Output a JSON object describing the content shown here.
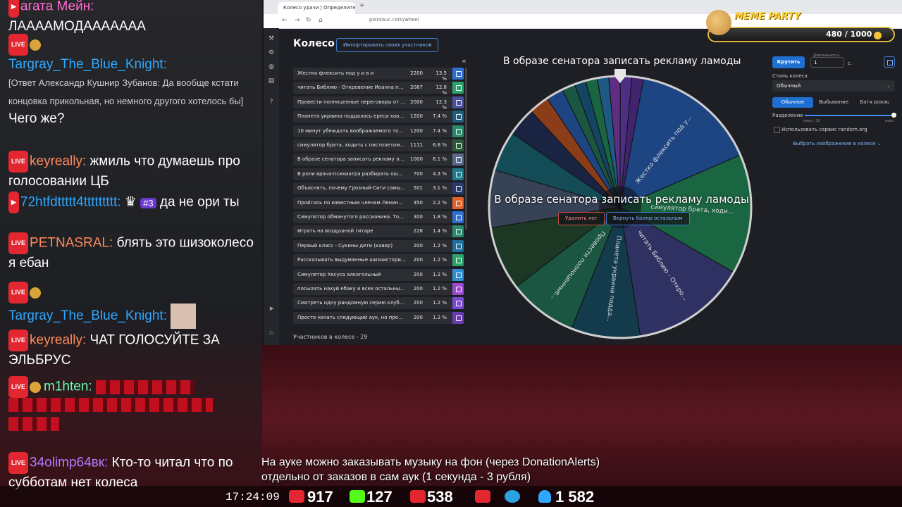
{
  "chat": {
    "messages": [
      {
        "nick": "агата Мейн:",
        "text": "ЛААААМОДААААААА"
      },
      {
        "nick": "Targray_The_Blue_Knight:",
        "reply": "[Ответ Александр Кушнир Зубанов: Да вообще кстати концовка прикольная, но немного другого хотелось бы]",
        "text": "Чего же?"
      },
      {
        "nick": "keyreally:",
        "text": "жмиль что думаешь про голосовании ЦБ"
      },
      {
        "nick": "72htfdttttt4ttttttttt:",
        "badge": "#3",
        "text": "да не ори ты"
      },
      {
        "nick": "PETNASRAL:",
        "text": "блять это шизоколесо я ебан"
      },
      {
        "nick": "Targray_The_Blue_Knight:",
        "text": ""
      },
      {
        "nick": "keyreally:",
        "text": "ЧАТ ГОЛОСУЙТЕ ЗА ЭЛЬБРУС"
      },
      {
        "nick": "m1hten:",
        "text": ""
      },
      {
        "nick": "34olimp64вк:",
        "text": "Кто-то читал что по субботам нет колеса"
      }
    ]
  },
  "browser": {
    "tab_title": "Колесо удачи | Определите о...",
    "url": "pointauc.com/wheel"
  },
  "page": {
    "title": "Колесо",
    "import_label": "Импортировать своих участников",
    "collapse": "«",
    "participants_count": "Участников в колесе - 29"
  },
  "lots": [
    {
      "name": "Жестко флексить под у и в и",
      "amount": "2200",
      "percent": "13.5 %",
      "color": "#2f6fd1"
    },
    {
      "name": "читать Библию - Откровение Иоанна под м...",
      "amount": "2087",
      "percent": "12.8 %",
      "color": "#2aa36b"
    },
    {
      "name": "Провести полноценные переговоры от лиц...",
      "amount": "2000",
      "percent": "12.3 %",
      "color": "#4a4f9e"
    },
    {
      "name": "Планета украина поддалась ереси хаоса(в...",
      "amount": "1200",
      "percent": "7.4 %",
      "color": "#1f5f7a"
    },
    {
      "name": "10 минут убеждать воображаемого топаза ...",
      "amount": "1200",
      "percent": "7.4 %",
      "color": "#2a8a6a"
    },
    {
      "name": "симулятор брата, ходить с пистолетом из па...",
      "amount": "1111",
      "percent": "6.8 %",
      "color": "#2d5a3a"
    },
    {
      "name": "В образе сенатора записать рекламу ламоды",
      "amount": "1000",
      "percent": "6.1 %",
      "color": "#5a6a8a"
    },
    {
      "name": "В роли врача-психиатра разбирать ошибки ...",
      "amount": "700",
      "percent": "4.3 %",
      "color": "#1f7a8a"
    },
    {
      "name": "Объяснять, почему Грозный-Сити самый до...",
      "amount": "501",
      "percent": "3.1 %",
      "color": "#2a3a6a"
    },
    {
      "name": "Пройтись по известным членам Ленинской ...",
      "amount": "350",
      "percent": "2.2 %",
      "color": "#e0622a"
    },
    {
      "name": "Симулятор обманутого россиянина. Только ...",
      "amount": "300",
      "percent": "1.8 %",
      "color": "#2f6fd1"
    },
    {
      "name": "Играть на воздушной гитаре",
      "amount": "228",
      "percent": "1.4 %",
      "color": "#2a8a6a"
    },
    {
      "name": "Первый класс - Сукины дети (кавер)",
      "amount": "200",
      "percent": "1.2 %",
      "color": "#1f6f9e"
    },
    {
      "name": "Рассказывать выдуманные шизоистории пр...",
      "amount": "200",
      "percent": "1.2 %",
      "color": "#2aa36b"
    },
    {
      "name": "Симулятор Хесуса алкогольный",
      "amount": "200",
      "percent": "1.2 %",
      "color": "#2f8fd1"
    },
    {
      "name": "посылать нахуй ебаку и всех остальных кто ...",
      "amount": "200",
      "percent": "1.2 %",
      "color": "#9a4ad1"
    },
    {
      "name": "Смотреть одну рандомную серию клуба Ми...",
      "amount": "200",
      "percent": "1.2 %",
      "color": "#7a4ad1"
    },
    {
      "name": "Просто начать следующий аук, но провести ...",
      "amount": "200",
      "percent": "1.2 %",
      "color": "#6a3ab1"
    }
  ],
  "wheel": {
    "winner": "В образе сенатора записать рекламу ламоды",
    "delete_label": "Удалить лот",
    "return_label": "Вернуть баллы остальным",
    "slice_labels": [
      "Жестко флексить под у...",
      "симулятор брата, ходи...",
      "читать Библию - Откро...",
      "Планета украина подда...",
      "Провести полноценные..."
    ]
  },
  "controls": {
    "spin_label": "Крутить",
    "duration_label": "Длительность",
    "duration_value": "1",
    "duration_unit": "с.",
    "style_label": "Стиль колеса",
    "style_value": "Обычный",
    "modes": [
      "Обычное",
      "Выбывание",
      "Батя рояль"
    ],
    "split_label": "Разделение",
    "split_min": "макс / 10",
    "split_max": "макс",
    "split_level": 1.0,
    "random_org_label": "Использовать сервис random.org",
    "pick_image_label": "Выбрать изображение в колесе"
  },
  "meme_party": {
    "title": "MEME PARTY",
    "value": "480 / 1000"
  },
  "caption": {
    "line1": "На ауке можно заказывать музыку на фон (через DonationAlerts)",
    "line2": "отдельно от заказов в сам аук (1 секунда - 3 рубля)"
  },
  "status": {
    "time": "17:24:09",
    "youtube": "917",
    "kick": "127",
    "vk": "538",
    "telegram_icon": "telegram-icon",
    "viewers": "1 582"
  },
  "colors": {
    "accent": "#1f6fd1",
    "live_badge": "#e3262f",
    "nick_blue": "#2fa8ff"
  }
}
